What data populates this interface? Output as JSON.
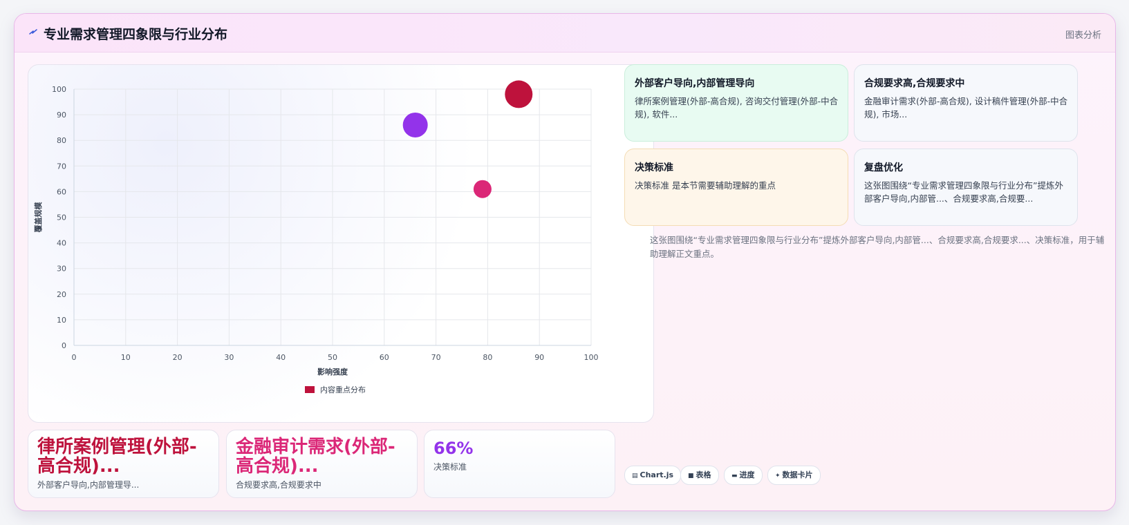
{
  "header": {
    "title": "专业需求管理四象限与行业分布",
    "title_icon": "lightning-icon",
    "right_label": "图表分析"
  },
  "chart_data": {
    "type": "scatter",
    "xlabel": "影响强度",
    "ylabel": "覆盖规模",
    "xlim": [
      0,
      100
    ],
    "ylim": [
      0,
      100
    ],
    "x_ticks": [
      0,
      10,
      20,
      30,
      40,
      50,
      60,
      70,
      80,
      90,
      100
    ],
    "y_ticks": [
      0,
      10,
      20,
      30,
      40,
      50,
      60,
      70,
      80,
      90,
      100
    ],
    "grid": true,
    "legend_position": "bottom",
    "series": [
      {
        "name": "内容重点分布",
        "color": "#be123c",
        "points": [
          {
            "x": 86,
            "y": 98,
            "r": 20,
            "color": "#be123c"
          },
          {
            "x": 66,
            "y": 86,
            "r": 18,
            "color": "#9333ea"
          },
          {
            "x": 79,
            "y": 61,
            "r": 13,
            "color": "#db2777"
          }
        ]
      }
    ]
  },
  "stats": [
    {
      "value": "律所案例管理(外部-高合规)...",
      "label": "外部客户导向,内部管理导...",
      "color": "#be123c"
    },
    {
      "value": "金融审计需求(外部-高合规)...",
      "label": "合规要求高,合规要求中",
      "color": "#db2777"
    },
    {
      "value": "66%",
      "label": "决策标准",
      "color": "#9333ea"
    }
  ],
  "cards": [
    {
      "title": "外部客户导向,内部管理导向",
      "body": "律所案例管理(外部-高合规), 咨询交付管理(外部-中合规), 软件..."
    },
    {
      "title": "合规要求高,合规要求中",
      "body": "金融审计需求(外部-高合规), 设计稿件管理(外部-中合规), 市场..."
    },
    {
      "title": "决策标准",
      "body": "决策标准 是本节需要辅助理解的重点"
    },
    {
      "title": "复盘优化",
      "body": "这张图围绕“专业需求管理四象限与行业分布”提炼外部客户导向,内部管...、合规要求高,合规要..."
    }
  ],
  "summary": "这张图围绕“专业需求管理四象限与行业分布”提炼外部客户导向,内部管...、合规要求高,合规要求...、决策标准，用于辅助理解正文重点。",
  "chips": [
    {
      "icon": "chart-icon",
      "label": "Chart.js"
    },
    {
      "icon": "table-icon",
      "label": "表格"
    },
    {
      "icon": "progress-icon",
      "label": "进度"
    },
    {
      "icon": "sparkle-icon",
      "label": "数据卡片"
    }
  ]
}
